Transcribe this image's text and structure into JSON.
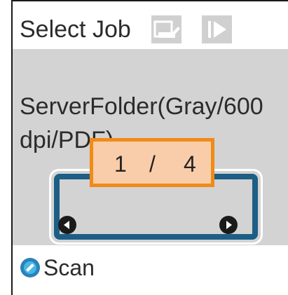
{
  "header": {
    "title": "Select Job",
    "icons": [
      "scan-settings-icon",
      "start-icon"
    ]
  },
  "job": {
    "line1": "ServerFolder(Gray/600",
    "line2": "dpi/PDF)"
  },
  "pager": {
    "current": "1",
    "separator": "/",
    "total": "4"
  },
  "footer": {
    "label": "Scan",
    "icon": "scan-icon"
  },
  "colors": {
    "highlight_border": "#1d5e85",
    "page_fill": "#f9cda9",
    "page_border": "#f08a19",
    "content_bg": "#d3d3d3"
  }
}
